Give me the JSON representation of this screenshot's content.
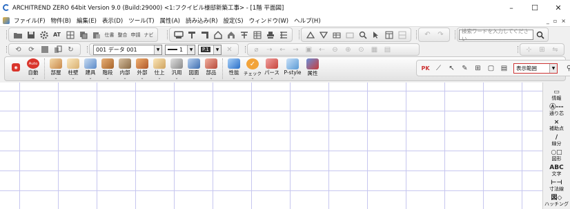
{
  "window": {
    "title": "ARCHITREND ZERO 64bit Version 9.0 (Build:29000) <1:フクイビル様邸新築工事> - [1階 平面図]",
    "minimize": "–",
    "maximize": "☐",
    "close": "✕"
  },
  "menu": {
    "items": [
      "ファイル(F)",
      "物件(B)",
      "編集(E)",
      "表示(D)",
      "ツール(T)",
      "属性(A)",
      "読み込み(R)",
      "設定(S)",
      "ウィンドウ(W)",
      "ヘルプ(H)"
    ],
    "mdi_min": "_",
    "mdi_restore": "▫",
    "mdi_close": "×"
  },
  "toolbar1": {
    "group1": [
      "folder-open",
      "save",
      "settings",
      "AT",
      "grid",
      "copy",
      "paste",
      "仕書",
      "整合",
      "申請",
      "ナビ"
    ],
    "group2": [
      "print-preview",
      "print",
      "export",
      "house",
      "house-3d",
      "text",
      "table",
      "stamp"
    ],
    "group3": [
      "triangle-up",
      "triangle-down",
      "layer",
      "layer-2",
      "zoom",
      "window",
      "window-2"
    ],
    "group4": [
      "undo",
      "redo"
    ],
    "search_placeholder": "検索ワードを入力してください"
  },
  "toolbar2": {
    "layer_value": "001  データ 001",
    "line_width_value": "1",
    "pen_value": "P.1",
    "zoom_labels": [
      "表示範囲"
    ]
  },
  "bigtools": [
    {
      "label": "自動",
      "color": "#d9342b",
      "badge": "Auto"
    },
    {
      "label": "部屋",
      "color": "#d8a25a"
    },
    {
      "label": "柱壁",
      "color": "#e8c27a"
    },
    {
      "label": "建具",
      "color": "#7aa6d8"
    },
    {
      "label": "階段",
      "color": "#c9853e"
    },
    {
      "label": "内部",
      "color": "#b08a5a"
    },
    {
      "label": "外部",
      "color": "#c6783a"
    },
    {
      "label": "仕上",
      "color": "#e2c38a"
    },
    {
      "label": "汎用",
      "color": "#9a9a9a"
    },
    {
      "label": "図面",
      "color": "#4f7dbf"
    },
    {
      "label": "部品",
      "color": "#d26a5a"
    },
    {
      "label": "性能",
      "color": "#3a7fd3"
    },
    {
      "label": "チェック",
      "color": "#f2a33a"
    },
    {
      "label": "パース",
      "color": "#c7453b"
    },
    {
      "label": "P-style",
      "color": "#5b9bd5"
    },
    {
      "label": "属性",
      "color": "#c73b3b"
    }
  ],
  "bigtools_right": {
    "range_label": "表示範囲"
  },
  "side_panel": [
    {
      "icon": "▭",
      "label": "情報"
    },
    {
      "icon": "Ⓐ---",
      "label": "通り芯"
    },
    {
      "icon": "×",
      "label": "補助点"
    },
    {
      "icon": "∕",
      "label": "線分"
    },
    {
      "icon": "○□",
      "label": "図形"
    },
    {
      "icon": "ABC",
      "label": "文字"
    },
    {
      "icon": "⊢⊣",
      "label": "寸法線"
    },
    {
      "icon": "図◇",
      "label": "ハッチング"
    }
  ],
  "colors": {
    "grid": "#c6c6ef",
    "accent_red": "#d9342b"
  }
}
